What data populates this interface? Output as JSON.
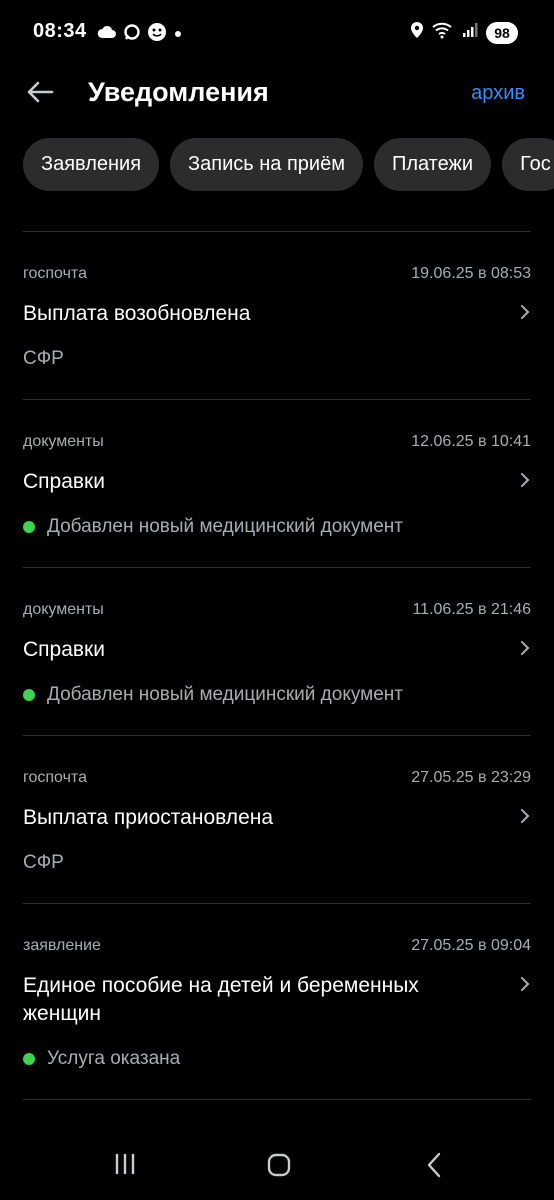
{
  "status_bar": {
    "time": "08:34",
    "battery": "98",
    "left_icons": [
      "cloud-icon",
      "chat-bubble-icon",
      "face-icon",
      "dot-icon"
    ],
    "right_icons": [
      "location-icon",
      "wifi-icon",
      "signal-icon"
    ]
  },
  "header": {
    "title": "Уведомления",
    "archive_label": "архив"
  },
  "chips": [
    "Заявления",
    "Запись на приём",
    "Платежи",
    "Гос"
  ],
  "notifications": [
    {
      "category": "госпочта",
      "date": "19.06.25 в 08:53",
      "title": "Выплата возобновлена",
      "subtitle": "СФР",
      "has_dot": false
    },
    {
      "category": "документы",
      "date": "12.06.25 в 10:41",
      "title": "Справки",
      "subtitle": "Добавлен новый медицинский документ",
      "has_dot": true
    },
    {
      "category": "документы",
      "date": "11.06.25 в 21:46",
      "title": "Справки",
      "subtitle": "Добавлен новый медицинский документ",
      "has_dot": true
    },
    {
      "category": "госпочта",
      "date": "27.05.25 в 23:29",
      "title": "Выплата приостановлена",
      "subtitle": "СФР",
      "has_dot": false
    },
    {
      "category": "заявление",
      "date": "27.05.25 в 09:04",
      "title": "Единое пособие на детей и беременных женщин",
      "subtitle": "Услуга оказана",
      "has_dot": true
    }
  ],
  "colors": {
    "background": "#000000",
    "accent": "#3b8cf5",
    "chip_bg": "#2c2c2e",
    "status_dot": "#3dd24f",
    "secondary_text": "#a9acb3"
  }
}
